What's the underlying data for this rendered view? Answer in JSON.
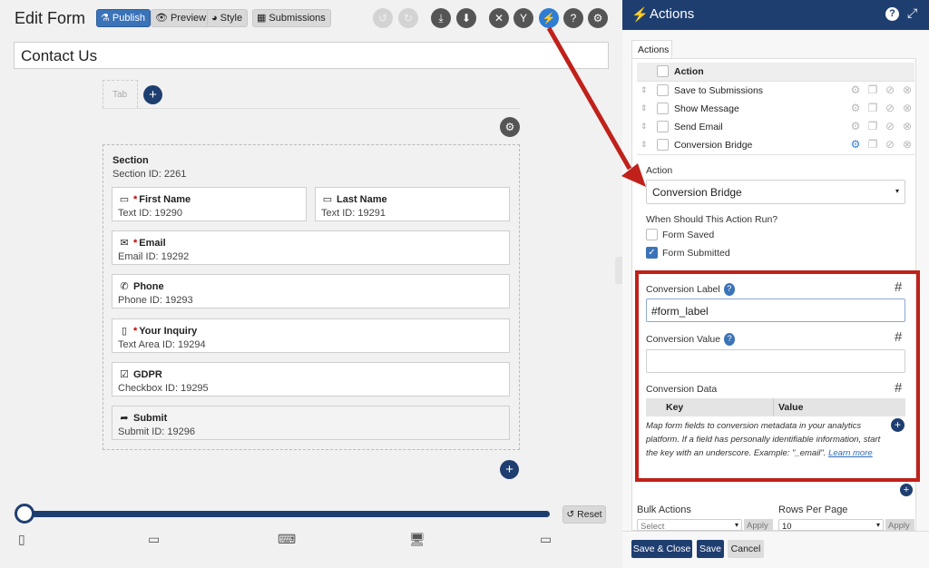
{
  "toolbar": {
    "title": "Edit Form",
    "publish_label": "Publish",
    "preview_label": "Preview",
    "style_label": "Style",
    "submissions_label": "Submissions"
  },
  "form": {
    "name_value": "Contact Us",
    "tab_label": "Tab",
    "section": {
      "title": "Section",
      "id_text": "Section  ID: 2261"
    },
    "fields": [
      {
        "name": "First Name",
        "required": true,
        "type_id": "Text  ID: 19290",
        "icon": "text-field-icon"
      },
      {
        "name": "Last Name",
        "required": false,
        "type_id": "Text  ID: 19291",
        "icon": "text-field-icon"
      },
      {
        "name": "Email",
        "required": true,
        "type_id": "Email  ID: 19292",
        "icon": "envelope-icon"
      },
      {
        "name": "Phone",
        "required": false,
        "type_id": "Phone  ID: 19293",
        "icon": "phone-icon"
      },
      {
        "name": "Your Inquiry",
        "required": true,
        "type_id": "Text Area  ID: 19294",
        "icon": "textarea-icon"
      },
      {
        "name": "GDPR",
        "required": false,
        "type_id": "Checkbox  ID: 19295",
        "icon": "checkbox-icon"
      },
      {
        "name": "Submit",
        "required": false,
        "type_id": "Submit  ID: 19296",
        "icon": "arrow-icon"
      }
    ],
    "required_mark": "*"
  },
  "preview": {
    "reset_label": "Reset"
  },
  "actions_panel": {
    "title": "Actions",
    "tab_label": "Actions",
    "table_header": "Action",
    "rows": [
      {
        "label": "Save to Submissions"
      },
      {
        "label": "Show Message"
      },
      {
        "label": "Send Email"
      },
      {
        "label": "Conversion Bridge"
      }
    ],
    "action_label": "Action",
    "action_value": "Conversion Bridge",
    "when_label": "When Should This Action Run?",
    "form_saved_label": "Form Saved",
    "form_submitted_label": "Form Submitted",
    "conversion_label_label": "Conversion Label",
    "conversion_label_value": "#form_label",
    "conversion_value_label": "Conversion Value",
    "conversion_value_value": "",
    "conversion_data_label": "Conversion Data",
    "key_header": "Key",
    "value_header": "Value",
    "help_text": "Map form fields to conversion metadata in your analytics platform. If a field has personally identifiable information, start the key with an underscore. Example: \"_email\".",
    "learn_more_label": "Learn more",
    "hash_symbol": "#",
    "help_symbol": "?",
    "bulk_actions_label": "Bulk Actions",
    "bulk_select_value": "Select",
    "apply_label": "Apply",
    "rows_per_page_label": "Rows Per Page",
    "rows_per_page_value": "10",
    "save_close_label": "Save & Close",
    "save_label": "Save",
    "cancel_label": "Cancel"
  },
  "colors": {
    "header_bg": "#1f3e70",
    "accent": "#3b73b9",
    "highlight_border": "#c0211b",
    "arrow": "#c0211b"
  }
}
